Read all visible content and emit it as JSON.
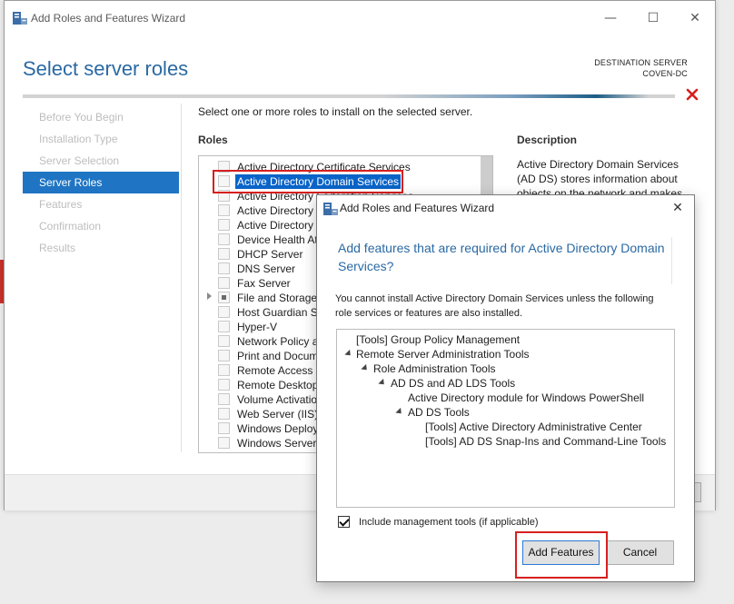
{
  "main_window": {
    "title": "Add Roles and Features Wizard",
    "page_title": "Select server roles",
    "destination_label": "DESTINATION SERVER",
    "destination_server": "COVEN-DC",
    "nav_items": [
      {
        "label": "Before You Begin",
        "active": false
      },
      {
        "label": "Installation Type",
        "active": false
      },
      {
        "label": "Server Selection",
        "active": false
      },
      {
        "label": "Server Roles",
        "active": true
      },
      {
        "label": "Features",
        "active": false
      },
      {
        "label": "Confirmation",
        "active": false
      },
      {
        "label": "Results",
        "active": false
      }
    ],
    "intro": "Select one or more roles to install on the selected server.",
    "roles_label": "Roles",
    "description_label": "Description",
    "description_text": "Active Directory Domain Services (AD DS) stores information about objects on the network and makes",
    "roles": [
      "Active Directory Certificate Services",
      "Active Directory Domain Services",
      "Active Directory Federation Services",
      "Active Directory",
      "Active Directory",
      "Device Health At",
      "DHCP Server",
      "DNS Server",
      "Fax Server",
      "File and Storage",
      "Host Guardian Se",
      "Hyper-V",
      "Network Policy a",
      "Print and Docum",
      "Remote Access",
      "Remote Desktop",
      "Volume Activatio",
      "Web Server (IIS)",
      "Windows Deploy",
      "Windows Server"
    ]
  },
  "dialog": {
    "title": "Add Roles and Features Wizard",
    "heading": "Add features that are required for Active Directory Domain Services?",
    "message": "You cannot install Active Directory Domain Services unless the following role services or features are also installed.",
    "tree": [
      "[Tools] Group Policy Management",
      "Remote Server Administration Tools",
      "Role Administration Tools",
      "AD DS and AD LDS Tools",
      "Active Directory module for Windows PowerShell",
      "AD DS Tools",
      "[Tools] Active Directory Administrative Center",
      "[Tools] AD DS Snap-Ins and Command-Line Tools"
    ],
    "include_tools_label": "Include management tools (if applicable)",
    "add_button": "Add Features",
    "cancel_button": "Cancel"
  },
  "colors": {
    "accent": "#2a69a3",
    "nav_active": "#1f75c3",
    "highlight": "#d71f1f",
    "selection": "#0a64c8"
  }
}
